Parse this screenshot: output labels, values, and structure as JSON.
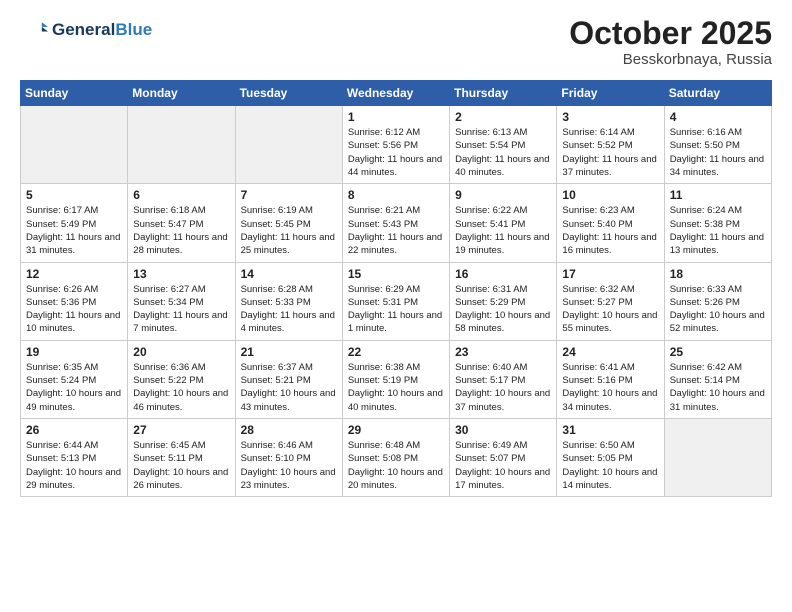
{
  "logo": {
    "line1": "General",
    "line2": "Blue"
  },
  "title": "October 2025",
  "location": "Besskorbnaya, Russia",
  "weekdays": [
    "Sunday",
    "Monday",
    "Tuesday",
    "Wednesday",
    "Thursday",
    "Friday",
    "Saturday"
  ],
  "weeks": [
    [
      {
        "day": "",
        "info": ""
      },
      {
        "day": "",
        "info": ""
      },
      {
        "day": "",
        "info": ""
      },
      {
        "day": "1",
        "info": "Sunrise: 6:12 AM\nSunset: 5:56 PM\nDaylight: 11 hours\nand 44 minutes."
      },
      {
        "day": "2",
        "info": "Sunrise: 6:13 AM\nSunset: 5:54 PM\nDaylight: 11 hours\nand 40 minutes."
      },
      {
        "day": "3",
        "info": "Sunrise: 6:14 AM\nSunset: 5:52 PM\nDaylight: 11 hours\nand 37 minutes."
      },
      {
        "day": "4",
        "info": "Sunrise: 6:16 AM\nSunset: 5:50 PM\nDaylight: 11 hours\nand 34 minutes."
      }
    ],
    [
      {
        "day": "5",
        "info": "Sunrise: 6:17 AM\nSunset: 5:49 PM\nDaylight: 11 hours\nand 31 minutes."
      },
      {
        "day": "6",
        "info": "Sunrise: 6:18 AM\nSunset: 5:47 PM\nDaylight: 11 hours\nand 28 minutes."
      },
      {
        "day": "7",
        "info": "Sunrise: 6:19 AM\nSunset: 5:45 PM\nDaylight: 11 hours\nand 25 minutes."
      },
      {
        "day": "8",
        "info": "Sunrise: 6:21 AM\nSunset: 5:43 PM\nDaylight: 11 hours\nand 22 minutes."
      },
      {
        "day": "9",
        "info": "Sunrise: 6:22 AM\nSunset: 5:41 PM\nDaylight: 11 hours\nand 19 minutes."
      },
      {
        "day": "10",
        "info": "Sunrise: 6:23 AM\nSunset: 5:40 PM\nDaylight: 11 hours\nand 16 minutes."
      },
      {
        "day": "11",
        "info": "Sunrise: 6:24 AM\nSunset: 5:38 PM\nDaylight: 11 hours\nand 13 minutes."
      }
    ],
    [
      {
        "day": "12",
        "info": "Sunrise: 6:26 AM\nSunset: 5:36 PM\nDaylight: 11 hours\nand 10 minutes."
      },
      {
        "day": "13",
        "info": "Sunrise: 6:27 AM\nSunset: 5:34 PM\nDaylight: 11 hours\nand 7 minutes."
      },
      {
        "day": "14",
        "info": "Sunrise: 6:28 AM\nSunset: 5:33 PM\nDaylight: 11 hours\nand 4 minutes."
      },
      {
        "day": "15",
        "info": "Sunrise: 6:29 AM\nSunset: 5:31 PM\nDaylight: 11 hours\nand 1 minute."
      },
      {
        "day": "16",
        "info": "Sunrise: 6:31 AM\nSunset: 5:29 PM\nDaylight: 10 hours\nand 58 minutes."
      },
      {
        "day": "17",
        "info": "Sunrise: 6:32 AM\nSunset: 5:27 PM\nDaylight: 10 hours\nand 55 minutes."
      },
      {
        "day": "18",
        "info": "Sunrise: 6:33 AM\nSunset: 5:26 PM\nDaylight: 10 hours\nand 52 minutes."
      }
    ],
    [
      {
        "day": "19",
        "info": "Sunrise: 6:35 AM\nSunset: 5:24 PM\nDaylight: 10 hours\nand 49 minutes."
      },
      {
        "day": "20",
        "info": "Sunrise: 6:36 AM\nSunset: 5:22 PM\nDaylight: 10 hours\nand 46 minutes."
      },
      {
        "day": "21",
        "info": "Sunrise: 6:37 AM\nSunset: 5:21 PM\nDaylight: 10 hours\nand 43 minutes."
      },
      {
        "day": "22",
        "info": "Sunrise: 6:38 AM\nSunset: 5:19 PM\nDaylight: 10 hours\nand 40 minutes."
      },
      {
        "day": "23",
        "info": "Sunrise: 6:40 AM\nSunset: 5:17 PM\nDaylight: 10 hours\nand 37 minutes."
      },
      {
        "day": "24",
        "info": "Sunrise: 6:41 AM\nSunset: 5:16 PM\nDaylight: 10 hours\nand 34 minutes."
      },
      {
        "day": "25",
        "info": "Sunrise: 6:42 AM\nSunset: 5:14 PM\nDaylight: 10 hours\nand 31 minutes."
      }
    ],
    [
      {
        "day": "26",
        "info": "Sunrise: 6:44 AM\nSunset: 5:13 PM\nDaylight: 10 hours\nand 29 minutes."
      },
      {
        "day": "27",
        "info": "Sunrise: 6:45 AM\nSunset: 5:11 PM\nDaylight: 10 hours\nand 26 minutes."
      },
      {
        "day": "28",
        "info": "Sunrise: 6:46 AM\nSunset: 5:10 PM\nDaylight: 10 hours\nand 23 minutes."
      },
      {
        "day": "29",
        "info": "Sunrise: 6:48 AM\nSunset: 5:08 PM\nDaylight: 10 hours\nand 20 minutes."
      },
      {
        "day": "30",
        "info": "Sunrise: 6:49 AM\nSunset: 5:07 PM\nDaylight: 10 hours\nand 17 minutes."
      },
      {
        "day": "31",
        "info": "Sunrise: 6:50 AM\nSunset: 5:05 PM\nDaylight: 10 hours\nand 14 minutes."
      },
      {
        "day": "",
        "info": ""
      }
    ]
  ]
}
